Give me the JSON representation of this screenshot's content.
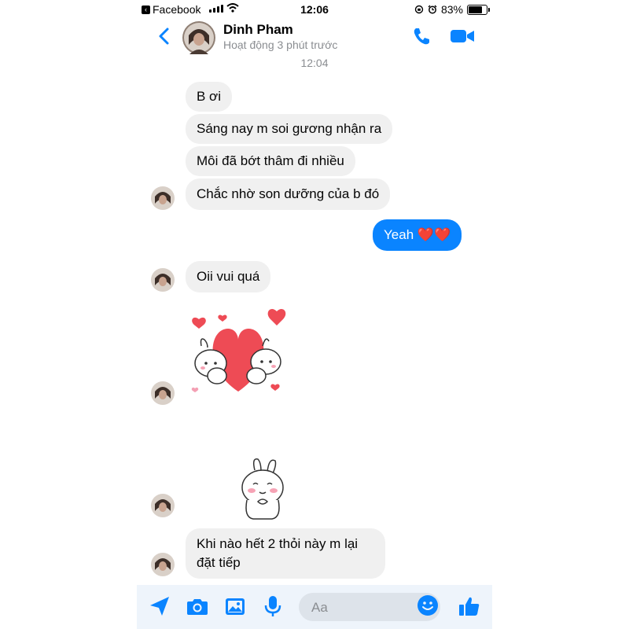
{
  "status_bar": {
    "back_app": "Facebook",
    "time": "12:06",
    "battery": "83%",
    "battery_level": 0.83
  },
  "header": {
    "name": "Dinh Pham",
    "status": "Hoạt động 3 phút trước"
  },
  "timestamp": "12:04",
  "messages": [
    {
      "from": "contact",
      "text": "B ơi"
    },
    {
      "from": "contact",
      "text": "Sáng nay m soi gương nhận ra"
    },
    {
      "from": "contact",
      "text": "Môi đã bớt thâm đi nhiều"
    },
    {
      "from": "contact",
      "text": "Chắc nhờ son dưỡng của b đó"
    },
    {
      "from": "me",
      "text": "Yeah ❤️❤️"
    },
    {
      "from": "contact",
      "text": "Oii vui quá"
    },
    {
      "from": "contact",
      "sticker": "heart-bunnies-sticker"
    },
    {
      "from": "contact",
      "sticker": "shy-bunny-sticker"
    },
    {
      "from": "contact",
      "text": "Khi nào hết 2 thỏi này m lại đặt tiếp"
    }
  ],
  "composer": {
    "placeholder": "Aa"
  },
  "colors": {
    "accent": "#0a84ff",
    "incoming_bubble": "#f0f0f0",
    "composer_bg": "#eef4fb"
  },
  "icons": [
    "back-chevron-icon",
    "phone-icon",
    "video-camera-icon",
    "send-location-icon",
    "camera-icon",
    "photo-icon",
    "microphone-icon",
    "emoji-icon",
    "thumbs-up-icon"
  ]
}
